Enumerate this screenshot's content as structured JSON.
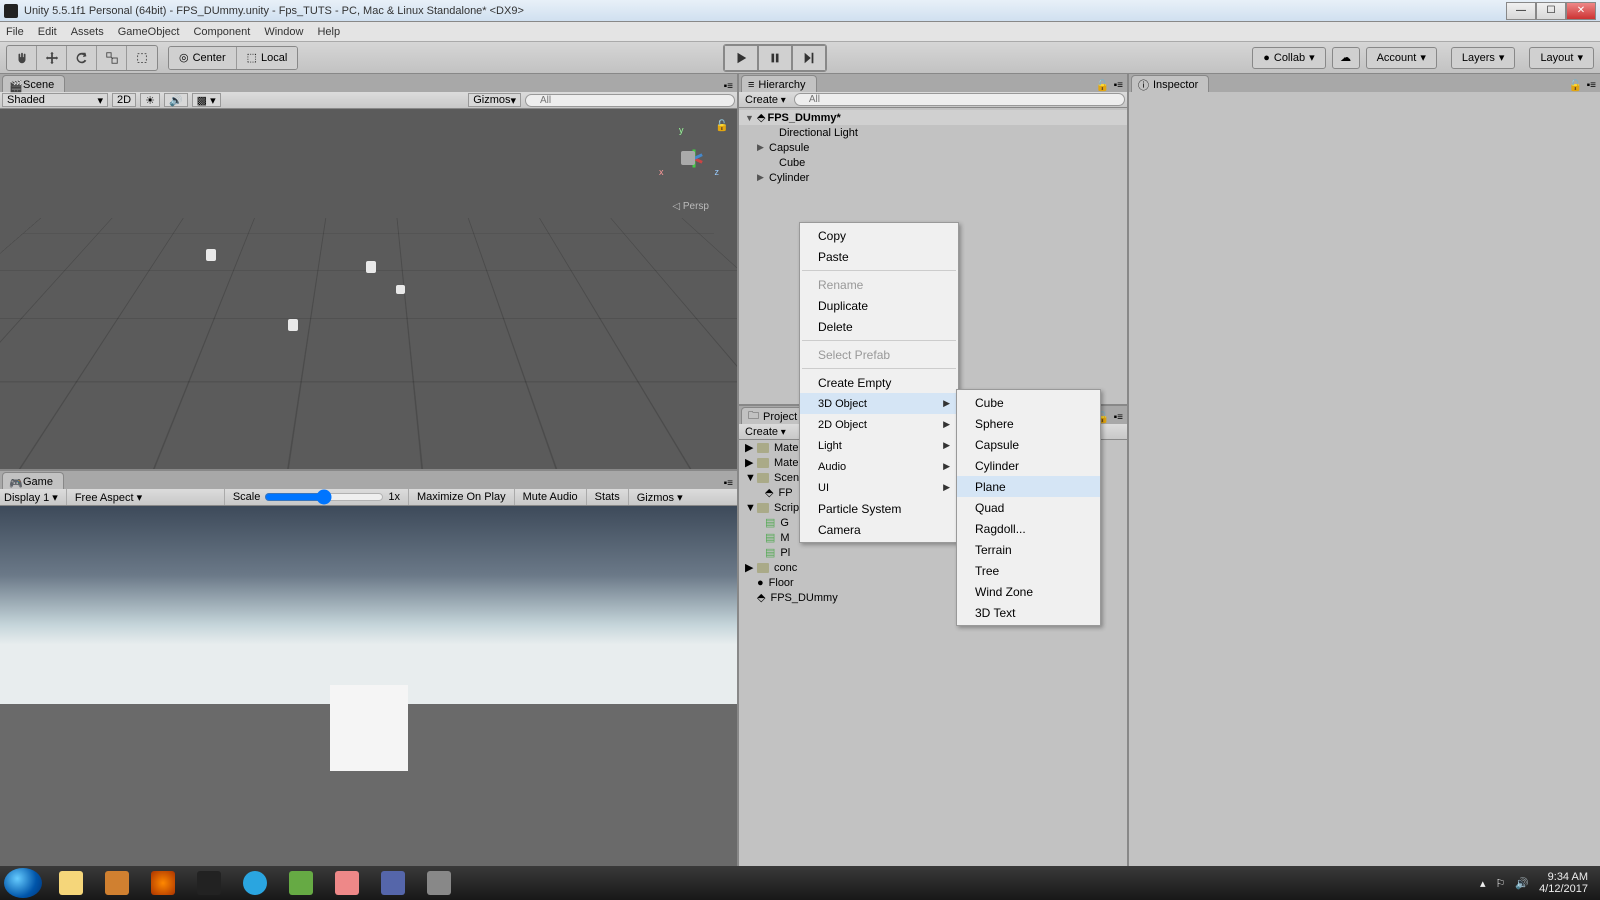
{
  "window": {
    "title": "Unity 5.5.1f1 Personal (64bit) - FPS_DUmmy.unity - Fps_TUTS - PC, Mac & Linux Standalone* <DX9>"
  },
  "menubar": [
    "File",
    "Edit",
    "Assets",
    "GameObject",
    "Component",
    "Window",
    "Help"
  ],
  "toolbar": {
    "pivot": "Center",
    "handle": "Local",
    "collab": "Collab",
    "account": "Account",
    "layers": "Layers",
    "layout": "Layout"
  },
  "scene": {
    "tab": "Scene",
    "shading": "Shaded",
    "mode2d": "2D",
    "gizmos": "Gizmos",
    "search_placeholder": "All",
    "persp": "Persp"
  },
  "game": {
    "tab": "Game",
    "display": "Display 1",
    "aspect": "Free Aspect",
    "scale_label": "Scale",
    "scale_val": "1x",
    "max_on_play": "Maximize On Play",
    "mute": "Mute Audio",
    "stats": "Stats",
    "gizmos": "Gizmos"
  },
  "hierarchy": {
    "tab": "Hierarchy",
    "create": "Create",
    "search_placeholder": "All",
    "scene_name": "FPS_DUmmy*",
    "items": [
      {
        "label": "Directional Light",
        "expandable": false,
        "indent": 1
      },
      {
        "label": "Capsule",
        "expandable": true,
        "indent": 1
      },
      {
        "label": "Cube",
        "expandable": false,
        "indent": 1
      },
      {
        "label": "Cylinder",
        "expandable": true,
        "indent": 1
      }
    ]
  },
  "project": {
    "tab": "Project",
    "create": "Create",
    "items": [
      {
        "label": "Mate",
        "type": "folder",
        "indent": 1
      },
      {
        "label": "Mate",
        "type": "folder",
        "indent": 1
      },
      {
        "label": "Scen",
        "type": "folder",
        "indent": 1,
        "open": true
      },
      {
        "label": "FP",
        "type": "asset",
        "indent": 2
      },
      {
        "label": "Scrip",
        "type": "folder",
        "indent": 1,
        "open": true
      },
      {
        "label": "G",
        "type": "script",
        "indent": 2
      },
      {
        "label": "M",
        "type": "script",
        "indent": 2
      },
      {
        "label": "Pl",
        "type": "script",
        "indent": 2
      },
      {
        "label": "conc",
        "type": "folder",
        "indent": 1
      },
      {
        "label": "Floor",
        "type": "material",
        "indent": 0
      },
      {
        "label": "FPS_DUmmy",
        "type": "scene",
        "indent": 0
      }
    ]
  },
  "inspector": {
    "tab": "Inspector"
  },
  "context_menu": {
    "items": [
      {
        "label": "Copy"
      },
      {
        "label": "Paste"
      },
      {
        "sep": true
      },
      {
        "label": "Rename",
        "disabled": true
      },
      {
        "label": "Duplicate"
      },
      {
        "label": "Delete"
      },
      {
        "sep": true
      },
      {
        "label": "Select Prefab",
        "disabled": true
      },
      {
        "sep": true
      },
      {
        "label": "Create Empty"
      },
      {
        "label": "3D Object",
        "submenu": true,
        "highlighted": true
      },
      {
        "label": "2D Object",
        "submenu": true
      },
      {
        "label": "Light",
        "submenu": true
      },
      {
        "label": "Audio",
        "submenu": true
      },
      {
        "label": "UI",
        "submenu": true
      },
      {
        "label": "Particle System"
      },
      {
        "label": "Camera"
      }
    ],
    "submenu_3d": [
      "Cube",
      "Sphere",
      "Capsule",
      "Cylinder",
      "Plane",
      "Quad",
      "Ragdoll...",
      "Terrain",
      "Tree",
      "Wind Zone",
      "3D Text"
    ],
    "submenu_highlight": "Plane"
  },
  "systray": {
    "time": "9:34 AM",
    "date": "4/12/2017"
  }
}
